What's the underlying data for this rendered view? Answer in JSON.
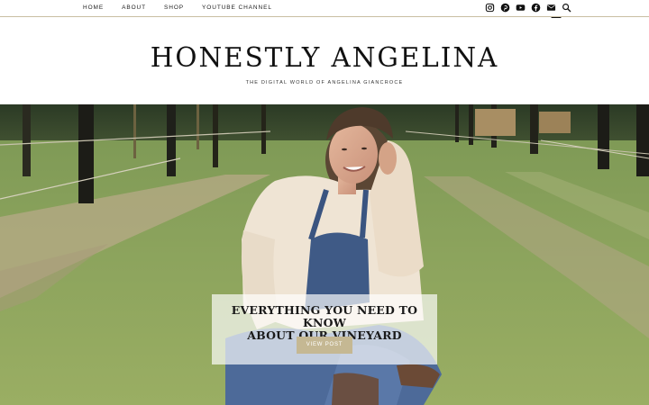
{
  "nav": {
    "items": [
      {
        "label": "HOME"
      },
      {
        "label": "ABOUT"
      },
      {
        "label": "SHOP"
      },
      {
        "label": "YOUTUBE CHANNEL"
      }
    ],
    "social_icons": [
      "instagram-icon",
      "pinterest-icon",
      "youtube-icon",
      "facebook-icon",
      "email-icon",
      "search-icon"
    ],
    "border_color": "#c9bfa3"
  },
  "header": {
    "site_title": "HONESTLY ANGELINA",
    "tagline": "THE DIGITAL WORLD OF ANGELINA GIANCROCE"
  },
  "featured": {
    "post_title_line1": "EVERYTHING YOU NEED TO KNOW",
    "post_title_line2": "ABOUT OUR VINEYARD",
    "button_label": "VIEW POST",
    "button_color": "#c5b893"
  }
}
